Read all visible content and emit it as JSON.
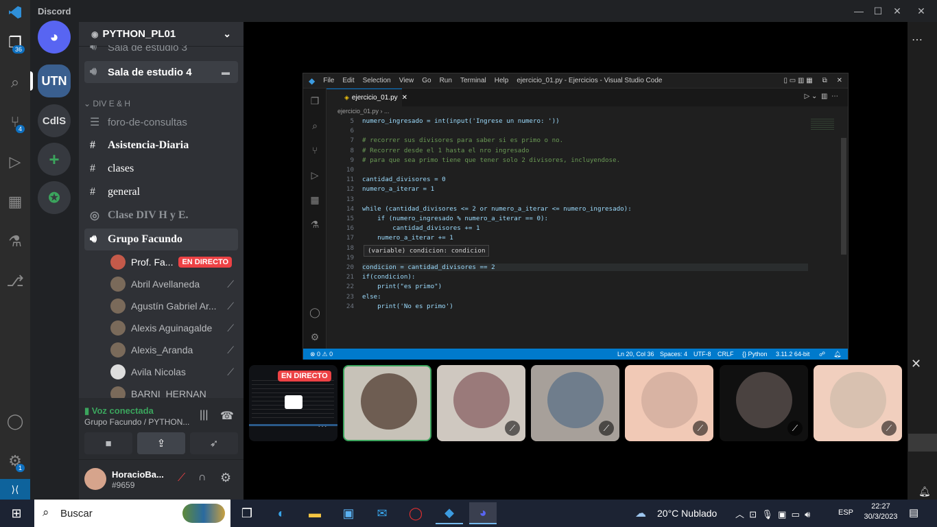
{
  "window": {
    "title": "Discord"
  },
  "outer_activity": {
    "explorer_badge": "36",
    "scm_badge": "4",
    "settings_badge": "1"
  },
  "guilds": {
    "utn": "UTN",
    "cdls": "CdlS"
  },
  "server": {
    "name": "PYTHON_PL01",
    "cut_channel": "Sala de estudio 3",
    "channels": [
      {
        "label": "Sala de estudio 4"
      },
      {
        "label": "foro-de-consultas"
      },
      {
        "label": "Asistencia-Diaria"
      },
      {
        "label": "clases"
      },
      {
        "label": "general"
      },
      {
        "label": "Clase DIV H y E."
      },
      {
        "label": "Grupo Facundo"
      }
    ],
    "category": "DIV E & H",
    "voice_users": [
      {
        "name": "Prof. Fa...",
        "live": "EN DIRECTO"
      },
      {
        "name": "Abril Avellaneda"
      },
      {
        "name": "Agustín Gabriel Ar..."
      },
      {
        "name": "Alexis Aguinagalde"
      },
      {
        "name": "Alexis_Aranda"
      },
      {
        "name": "Avila Nicolas"
      },
      {
        "name": "BARNI_HERNAN"
      }
    ]
  },
  "voice": {
    "status": "Voz conectada",
    "channel": "Grupo Facundo / PYTHON..."
  },
  "user": {
    "name": "HoracioBa...",
    "tag": "#9659"
  },
  "stream": {
    "live_label": "EN DIRECTO"
  },
  "ivs": {
    "menu": [
      "File",
      "Edit",
      "Selection",
      "View",
      "Go",
      "Run",
      "Terminal",
      "Help"
    ],
    "title": "ejercicio_01.py - Ejercicios - Visual Studio Code",
    "tab": "ejercicio_01.py",
    "breadcrumb": "ejercicio_01.py › ...",
    "hover": "(variable) condicion: condicion",
    "status": {
      "problems": "⊗ 0 ⚠ 0",
      "position": "Ln 20, Col 36",
      "spaces": "Spaces: 4",
      "encoding": "UTF-8",
      "eol": "CRLF",
      "language": "Python",
      "interpreter": "3.11.2 64-bit"
    }
  },
  "code": [
    {
      "n": "5",
      "t": "numero_ingresado = int(input('Ingrese un numero: '))"
    },
    {
      "n": "6",
      "t": ""
    },
    {
      "n": "7",
      "t": "# recorrer sus divisores para saber si es primo o no."
    },
    {
      "n": "8",
      "t": "# Recorrer desde el 1 hasta el nro ingresado"
    },
    {
      "n": "9",
      "t": "# para que sea primo tiene que tener solo 2 divisores, incluyendose."
    },
    {
      "n": "10",
      "t": ""
    },
    {
      "n": "11",
      "t": "cantidad_divisores = 0"
    },
    {
      "n": "12",
      "t": "numero_a_iterar = 1"
    },
    {
      "n": "13",
      "t": ""
    },
    {
      "n": "14",
      "t": "while (cantidad_divisores <= 2 or numero_a_iterar <= numero_ingresado):"
    },
    {
      "n": "15",
      "t": "    if (numero_ingresado % numero_a_iterar == 0):"
    },
    {
      "n": "16",
      "t": "        cantidad_divisores += 1"
    },
    {
      "n": "17",
      "t": "    numero_a_iterar += 1"
    },
    {
      "n": "18",
      "t": ""
    },
    {
      "n": "19",
      "t": ""
    },
    {
      "n": "20",
      "t": "condicion = cantidad_divisores == 2"
    },
    {
      "n": "21",
      "t": "if(condicion):"
    },
    {
      "n": "22",
      "t": "    print(\"es primo\")"
    },
    {
      "n": "23",
      "t": "else:"
    },
    {
      "n": "24",
      "t": "    print('No es primo')"
    }
  ],
  "taskbar": {
    "search_placeholder": "Buscar",
    "weather": "20°C  Nublado",
    "lang": "ESP",
    "time": "22:27",
    "date": "30/3/2023"
  }
}
